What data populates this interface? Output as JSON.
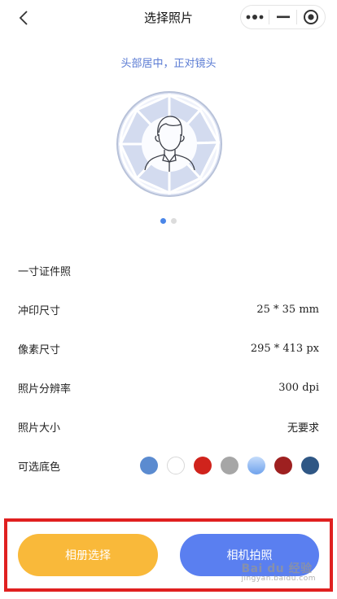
{
  "nav": {
    "title": "选择照片"
  },
  "hint": "头部居中，正对镜头",
  "carousel": {
    "count": 2,
    "active_index": 0
  },
  "spec": {
    "name": "一寸证件照",
    "rows": [
      {
        "label": "冲印尺寸",
        "value": "25 * 35 mm"
      },
      {
        "label": "像素尺寸",
        "value": "295 * 413 px"
      },
      {
        "label": "照片分辨率",
        "value": "300 dpi"
      },
      {
        "label": "照片大小",
        "value": "无要求"
      }
    ],
    "bg_label": "可选底色",
    "bg_colors": [
      "#5b8bd0",
      "#ffffff",
      "#d0231c",
      "#a6a6a6",
      "#8fb8f0",
      "#9e2020",
      "#2f5785"
    ]
  },
  "buttons": {
    "album": "相册选择",
    "camera": "相机拍照"
  },
  "watermark": {
    "brand": "Bai du 经验",
    "url": "jingyan.baidu.com"
  }
}
